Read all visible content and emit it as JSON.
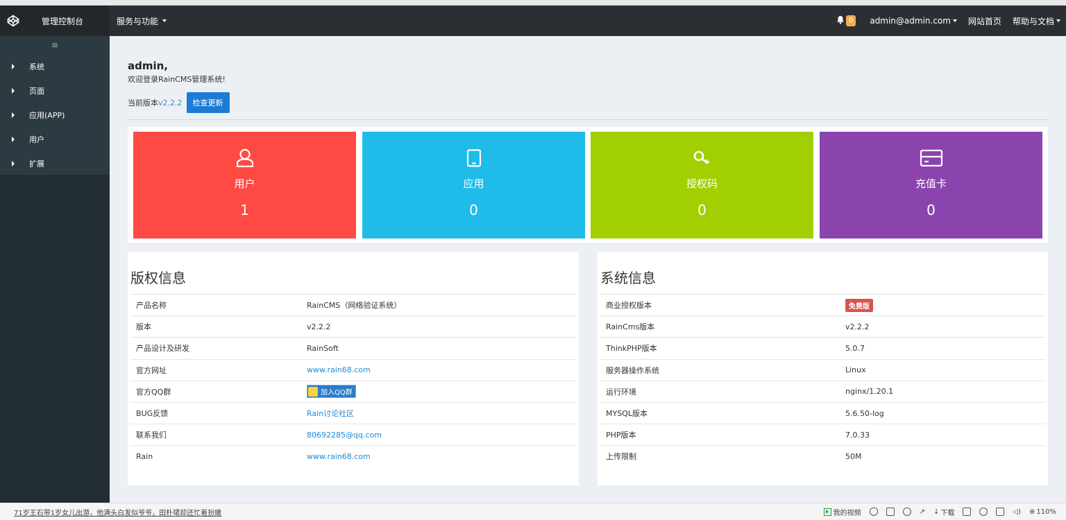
{
  "navbar": {
    "brand_title": "管理控制台",
    "menu_label": "服务与功能",
    "bell_count": "0",
    "user": "admin@admin.com",
    "home_link": "网站首页",
    "help_label": "帮助与文档"
  },
  "sidebar": {
    "toggle": "≡",
    "items": [
      {
        "label": "系统"
      },
      {
        "label": "页面"
      },
      {
        "label": "应用(APP)"
      },
      {
        "label": "用户"
      },
      {
        "label": "扩展"
      }
    ]
  },
  "welcome": {
    "user": "admin,",
    "message": "欢迎登录RainCMS管理系统!",
    "version_label": "当前版本",
    "version": "v2.2.2",
    "update_button": "检查更新"
  },
  "stats": [
    {
      "label": "用户",
      "value": "1",
      "color": "#ff4a44",
      "icon": "user-icon"
    },
    {
      "label": "应用",
      "value": "0",
      "color": "#1fbbe9",
      "icon": "tablet-icon"
    },
    {
      "label": "授权码",
      "value": "0",
      "color": "#a2cf01",
      "icon": "key-icon"
    },
    {
      "label": "充值卡",
      "value": "0",
      "color": "#8b44ad",
      "icon": "card-icon"
    }
  ],
  "copyright": {
    "title": "版权信息",
    "rows": [
      {
        "key": "产品名称",
        "value": "RainCMS（网络验证系统）"
      },
      {
        "key": "版本",
        "value": "v2.2.2"
      },
      {
        "key": "产品设计及研发",
        "value": "RainSoft"
      },
      {
        "key": "官方网址",
        "value": "www.rain68.com"
      },
      {
        "key": "官方QQ群",
        "value": "加入QQ群"
      },
      {
        "key": "BUG反馈",
        "value": "Rain讨论社区"
      },
      {
        "key": "联系我们",
        "value": "80692285@qq.com"
      },
      {
        "key": "Rain",
        "value": "www.rain68.com"
      }
    ]
  },
  "sysinfo": {
    "title": "系统信息",
    "rows": [
      {
        "key": "商业授权版本",
        "value": "免费版"
      },
      {
        "key": "RainCms版本",
        "value": "v2.2.2"
      },
      {
        "key": "ThinkPHP版本",
        "value": "5.0.7"
      },
      {
        "key": "服务器操作系统",
        "value": "Linux"
      },
      {
        "key": "运行环境",
        "value": "nginx/1.20.1"
      },
      {
        "key": "MYSQL版本",
        "value": "5.6.50-log"
      },
      {
        "key": "PHP版本",
        "value": "7.0.33"
      },
      {
        "key": "上传限制",
        "value": "50M"
      }
    ]
  },
  "statusbar": {
    "news": "71岁王石带1岁女儿出游，他满头白发似爷爷，田朴珺却还忙着扮嫩",
    "video": "我的视频",
    "download": "下载",
    "zoom": "110%"
  }
}
